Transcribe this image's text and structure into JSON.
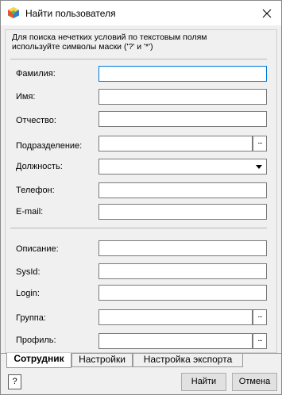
{
  "window": {
    "title": "Найти пользователя"
  },
  "hint": "Для поиска нечетких условий по текстовым полям используйте символы маски ('?' и '*')",
  "fields": {
    "lastname": {
      "label": "Фамилия:",
      "value": ""
    },
    "firstname": {
      "label": "Имя:",
      "value": ""
    },
    "middlename": {
      "label": "Отчество:",
      "value": ""
    },
    "department": {
      "label": "Подразделение:",
      "value": "",
      "button": "..."
    },
    "position": {
      "label": "Должность:",
      "value": ""
    },
    "phone": {
      "label": "Телефон:",
      "value": ""
    },
    "email": {
      "label": "E-mail:",
      "value": ""
    },
    "description": {
      "label": "Описание:",
      "value": ""
    },
    "sysid": {
      "label": "SysId:",
      "value": ""
    },
    "login": {
      "label": "Login:",
      "value": ""
    },
    "group": {
      "label": "Группа:",
      "value": "",
      "button": "..."
    },
    "profile": {
      "label": "Профиль:",
      "value": "",
      "button": "..."
    }
  },
  "tabs": [
    "Сотрудник",
    "Настройки",
    "Настройка экспорта"
  ],
  "buttons": {
    "help": "?",
    "find": "Найти",
    "cancel": "Отмена"
  }
}
